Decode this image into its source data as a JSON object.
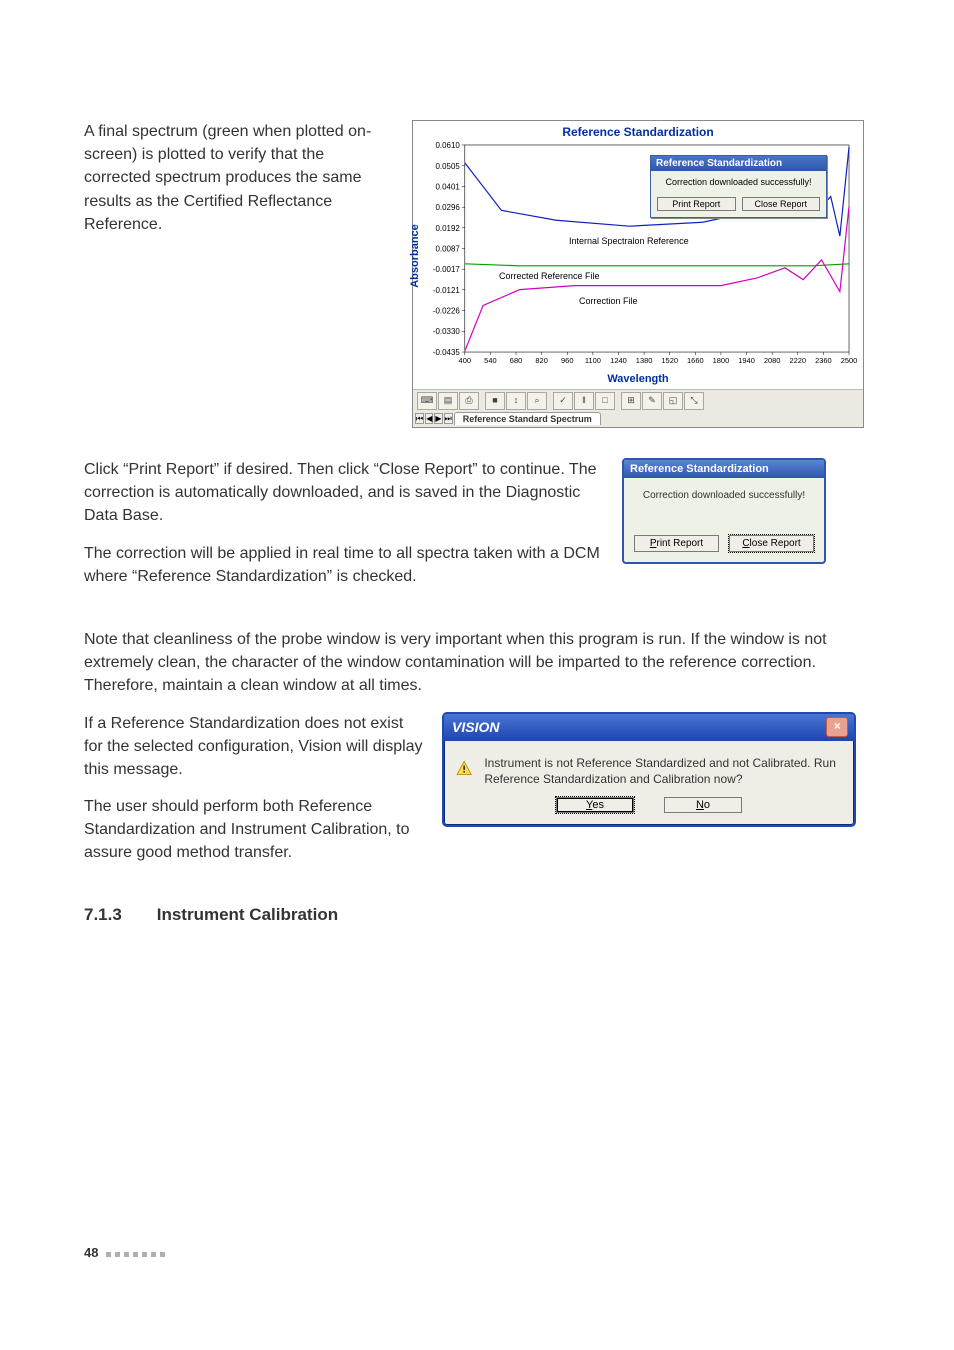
{
  "body": {
    "para1": "A final spectrum (green when plotted on-screen) is plotted to verify that the corrected spectrum produces the same results as the Certified Reflectance Reference.",
    "para2": "Click “Print Report” if desired. Then click “Close Report” to continue. The correction is automatically downloaded, and is saved in the Diagnostic Data Base.",
    "para3": "The correction will be applied in real time to all spectra taken with a DCM where “Reference Standardization” is checked.",
    "para4": "Note that cleanliness of the probe window is very important when this program is run. If the window is not extremely clean, the character of the window contamination will be imparted to the reference correction. Therefore, maintain a clean window at all times.",
    "para5": "If a Reference Standardization does not exist for the selected configuration, Vision will display this message.",
    "para6": "The user should perform both Reference Standardization and Instrument Calibration, to assure good method transfer."
  },
  "heading": {
    "num": "7.1.3",
    "title": "Instrument Calibration"
  },
  "chart": {
    "title": "Reference Standardization",
    "ylabel": "Absorbance",
    "xlabel": "Wavelength",
    "annot_internal": "Internal Spectralon Reference",
    "annot_corrected": "Corrected Reference File",
    "annot_correction": "Correction File",
    "tab": "Reference Standard Spectrum"
  },
  "chart_data": {
    "type": "line",
    "title": "Reference Standardization",
    "xlabel": "Wavelength",
    "ylabel": "Absorbance",
    "xlim": [
      400,
      2500
    ],
    "ylim": [
      -0.0435,
      0.061
    ],
    "xticks": [
      400,
      540,
      680,
      820,
      960,
      1100,
      1240,
      1380,
      1520,
      1660,
      1800,
      1940,
      2080,
      2220,
      2360,
      2500
    ],
    "yticks": [
      0.061,
      0.0505,
      0.0401,
      0.0296,
      0.0192,
      0.0087,
      -0.0017,
      -0.0121,
      -0.0226,
      -0.033,
      -0.0435
    ],
    "series": [
      {
        "name": "Internal Spectralon Reference",
        "color": "#1020c0",
        "x": [
          400,
          600,
          900,
          1300,
          1700,
          1900,
          2100,
          2200,
          2300,
          2400,
          2450,
          2500
        ],
        "y": [
          0.052,
          0.028,
          0.023,
          0.02,
          0.022,
          0.026,
          0.026,
          0.03,
          0.025,
          0.035,
          0.015,
          0.06
        ]
      },
      {
        "name": "Corrected Reference File",
        "color": "#00a000",
        "x": [
          400,
          700,
          1100,
          1500,
          1900,
          2100,
          2300,
          2500
        ],
        "y": [
          0.001,
          0.0,
          0.0,
          0.0,
          0.0,
          0.0,
          0.0,
          0.001
        ]
      },
      {
        "name": "Correction File",
        "color": "#d000c0",
        "x": [
          400,
          500,
          700,
          1000,
          1400,
          1800,
          2000,
          2150,
          2250,
          2350,
          2450,
          2500
        ],
        "y": [
          -0.043,
          -0.02,
          -0.012,
          -0.01,
          -0.01,
          -0.01,
          -0.006,
          -0.001,
          -0.007,
          0.003,
          -0.013,
          0.03
        ]
      }
    ],
    "annotations": [
      {
        "text": "Internal Spectralon Reference",
        "at": [
          1350,
          0.02
        ]
      },
      {
        "text": "Corrected Reference File",
        "at": [
          900,
          -0.0017
        ]
      },
      {
        "text": "Correction File",
        "at": [
          1350,
          -0.0121
        ]
      }
    ]
  },
  "mini_dialog": {
    "title": "Reference Standardization",
    "message": "Correction downloaded successfully!",
    "print": "Print Report",
    "close": "Close Report"
  },
  "rs_dialog": {
    "title": "Reference Standardization",
    "message": "Correction downloaded successfully!",
    "print_prefix": "P",
    "print_rest": "rint Report",
    "close_prefix": "C",
    "close_rest": "lose Report"
  },
  "vision_dialog": {
    "title": "VISION",
    "message": "Instrument is not Reference Standardized and not Calibrated. Run Reference Standardization and Calibration now?",
    "yes_prefix": "Y",
    "yes_rest": "es",
    "no_prefix": "N",
    "no_rest": "o",
    "close_x": "×"
  },
  "toolbar_icons": [
    "⌨",
    "▤",
    "⎙",
    "■",
    "↕",
    "⌕",
    "✓",
    "‖",
    "□",
    "⊞",
    "✎",
    "◱",
    "⤡"
  ],
  "nav_btns": [
    "⏮",
    "◀",
    "▶",
    "⏭"
  ],
  "footer": {
    "page": "48"
  }
}
